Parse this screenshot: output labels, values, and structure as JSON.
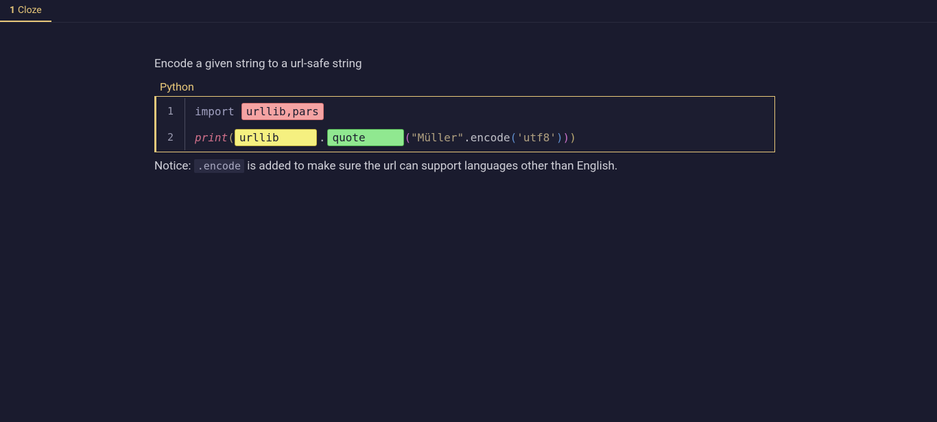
{
  "tab": {
    "number": "1",
    "label": "Cloze"
  },
  "prompt": "Encode a given string to a url-safe string",
  "code": {
    "label": "Python",
    "lines": [
      {
        "num": "1",
        "import_kw": "import",
        "cloze_pink": "urllib,pars"
      },
      {
        "num": "2",
        "print_fn": "print",
        "cloze_yellow": "urllib",
        "cloze_green": "quote",
        "string1": "\"Müller\"",
        "method": ".encode",
        "string2": "'utf8'"
      }
    ]
  },
  "notice": {
    "prefix": "Notice: ",
    "code": ".encode",
    "suffix": " is added to make sure the url can support languages other than English."
  }
}
